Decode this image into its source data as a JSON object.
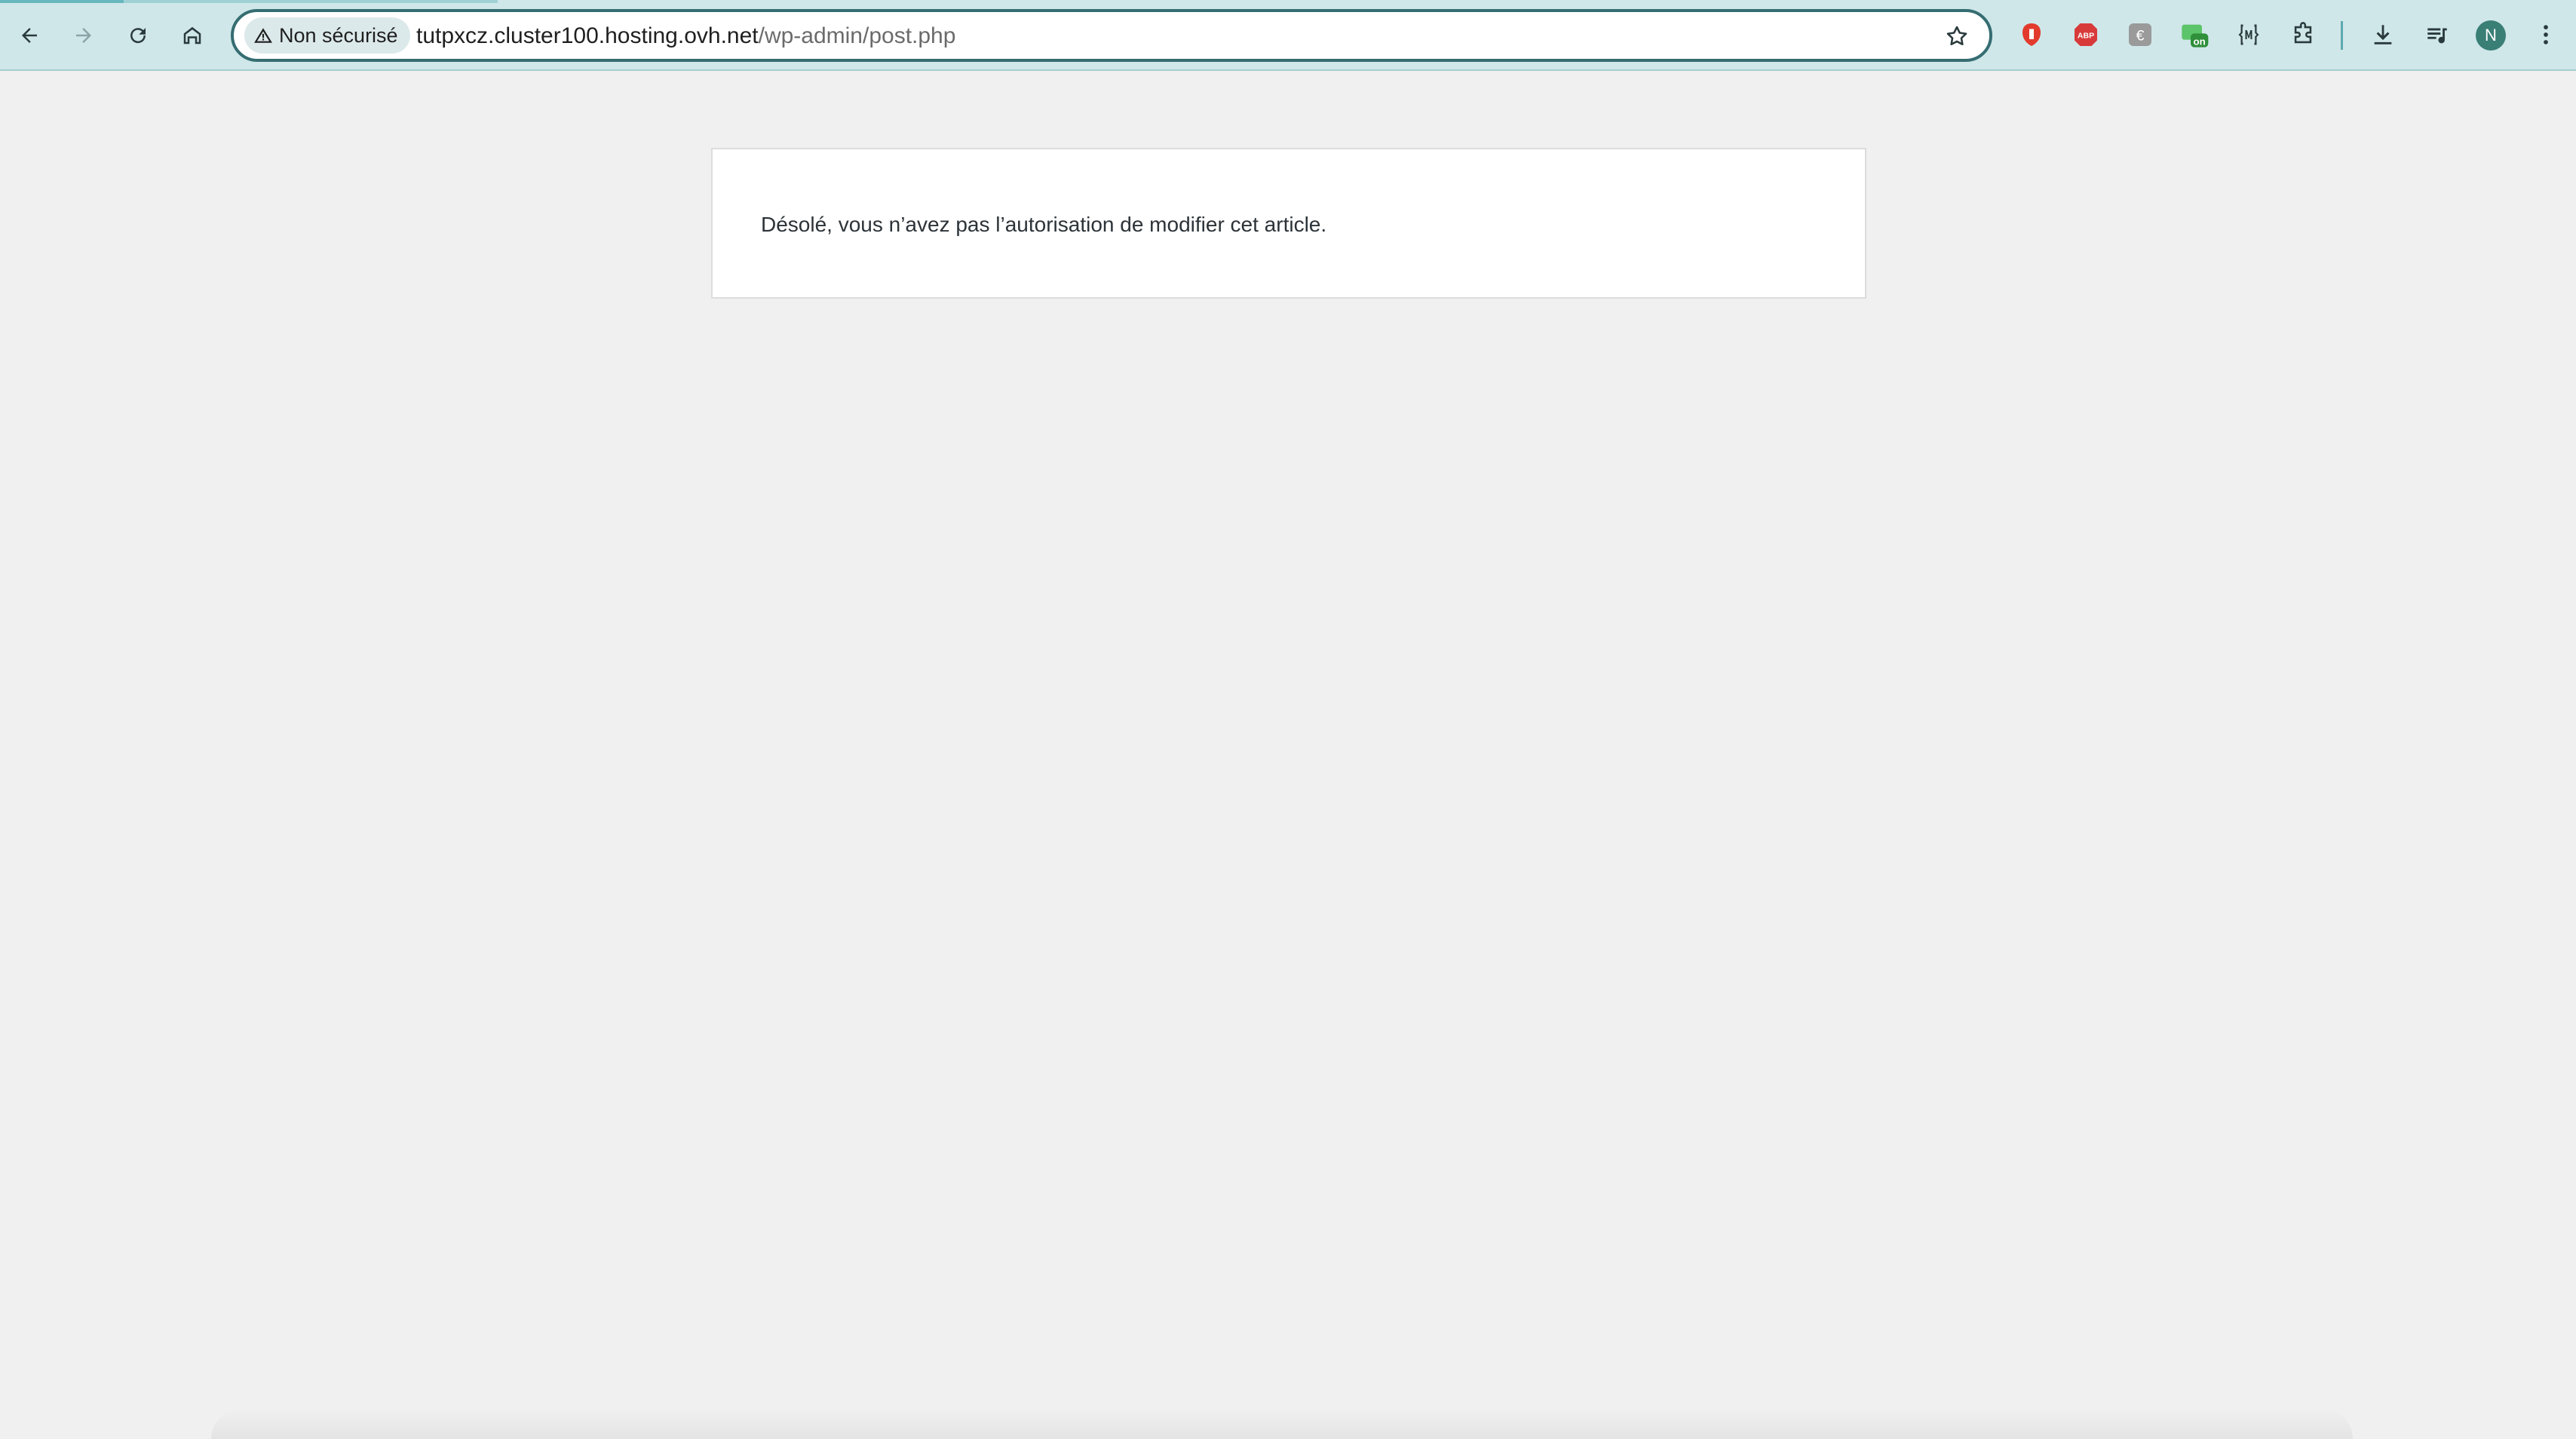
{
  "browser": {
    "security_label": "Non sécurisé",
    "url_host": "tutpxcz.cluster100.hosting.ovh.net",
    "url_path": "/wp-admin/post.php",
    "extensions": [
      {
        "name": "shield-extension-icon",
        "color": "#e23b2e"
      },
      {
        "name": "adblock-extension-icon",
        "label": "ABP",
        "color": "#d83a3a"
      },
      {
        "name": "euro-extension-icon",
        "label": "€",
        "color": "#9a9a9a"
      },
      {
        "name": "on-extension-icon",
        "label": "on",
        "color": "#2f8f3a"
      },
      {
        "name": "wappalyzer-extension-icon",
        "label": "{w}"
      }
    ],
    "profile_initial": "N",
    "colors": {
      "toolbar": "#cfe7e9",
      "omnibox_border": "#356d72",
      "avatar": "#3a7f76"
    }
  },
  "page": {
    "message": "Désolé, vous n’avez pas l’autorisation de modifier cet article.",
    "colors": {
      "background": "#f0f0f1",
      "box": "#ffffff",
      "text": "#2c3338"
    }
  }
}
